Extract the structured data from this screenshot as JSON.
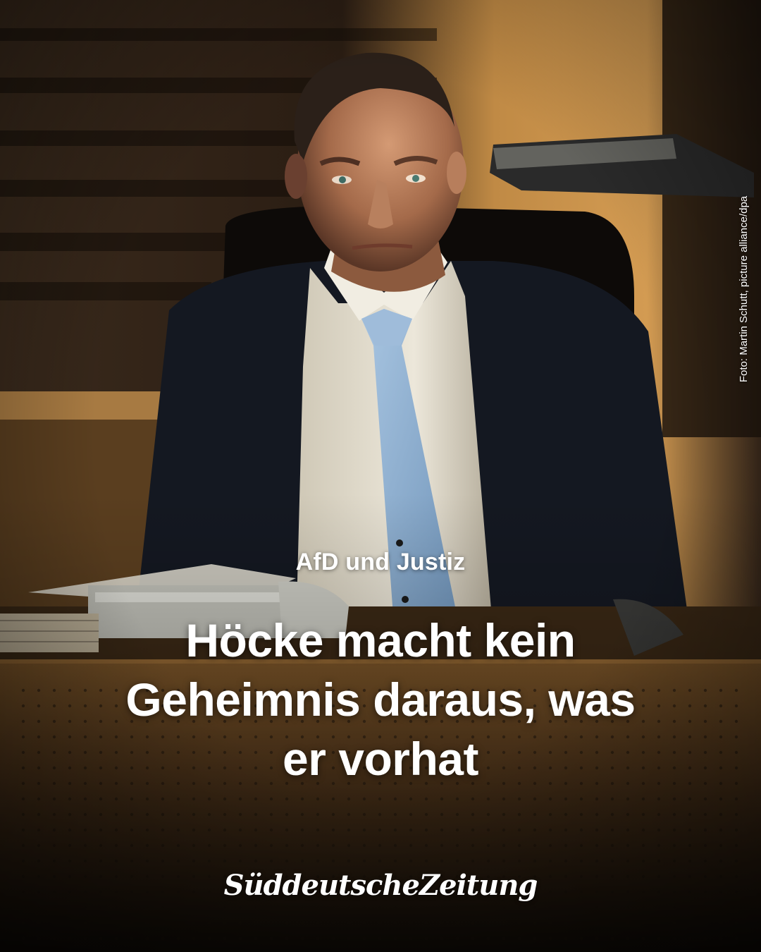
{
  "post": {
    "kicker": "AfD und Justiz",
    "headline_lines": [
      "Höcke macht kein",
      "Geheimnis daraus, was",
      "er vorhat"
    ],
    "photo_credit": "Foto: Martin Schutt, picture alliance/dpa",
    "brand_logo": "SüddeutscheZeitung"
  },
  "colors": {
    "text": "#ffffff",
    "background_dark": "#1a120b",
    "wood_warm": "#b9853f",
    "tie_blue": "#8fb3d6",
    "shirt": "#e9e4d6",
    "suit": "#151a24"
  }
}
